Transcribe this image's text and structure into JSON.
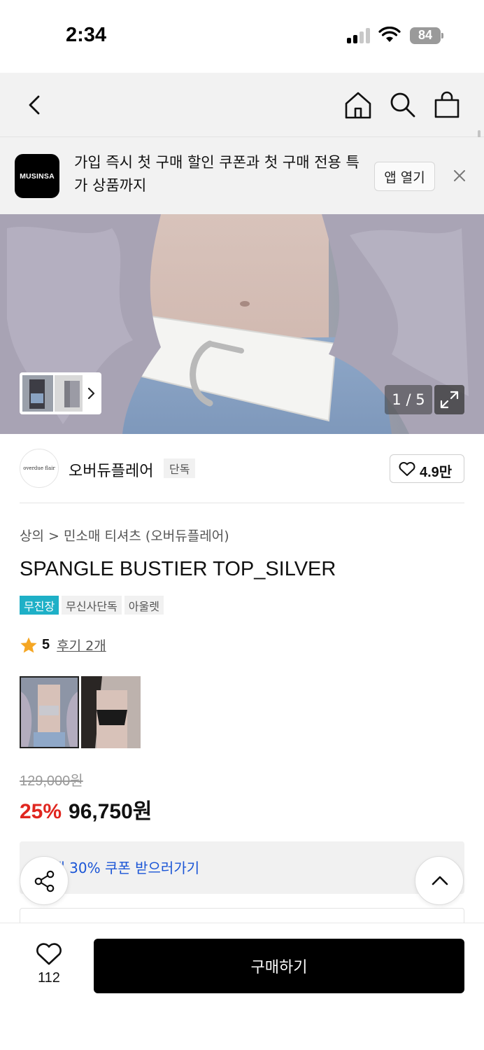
{
  "status_bar": {
    "time": "2:34",
    "battery": "84"
  },
  "nav": {
    "back_icon": "chevron-left-icon",
    "home_icon": "home-icon",
    "search_icon": "search-icon",
    "cart_icon": "shopping-bag-icon"
  },
  "app_banner": {
    "logo_text": "MUSINSA",
    "message": "가입 즉시 첫 구매 할인 쿠폰과 첫 구매 전용 특가 상품까지",
    "open_button": "앱 열기",
    "close_icon": "close-icon"
  },
  "gallery": {
    "counter": "1 / 5",
    "expand_icon": "expand-icon",
    "thumb_next_icon": "chevron-right-icon"
  },
  "brand": {
    "logo_text": "overdue flair",
    "name": "오버듀플레어",
    "badge": "단독",
    "likes": "4.9만"
  },
  "product": {
    "breadcrumb": "상의 > 민소매 티셔츠 (오버듀플레어)",
    "title": "SPANGLE BUSTIER TOP_SILVER",
    "tags": [
      "무진장",
      "무신사단독",
      "아울렛"
    ],
    "rating": "5",
    "review_link": "후기 2개",
    "original_price": "129,000원",
    "discount": "25%",
    "final_price": "96,750원",
    "coupon_text": "구매 30% 쿠폰 받으러가기"
  },
  "bottom_bar": {
    "like_count": "112",
    "buy_label": "구매하기"
  },
  "colors": {
    "accent_teal": "#1eb0c7",
    "discount_red": "#e0261f",
    "coupon_blue": "#1a55d6",
    "star": "#f5a623"
  }
}
